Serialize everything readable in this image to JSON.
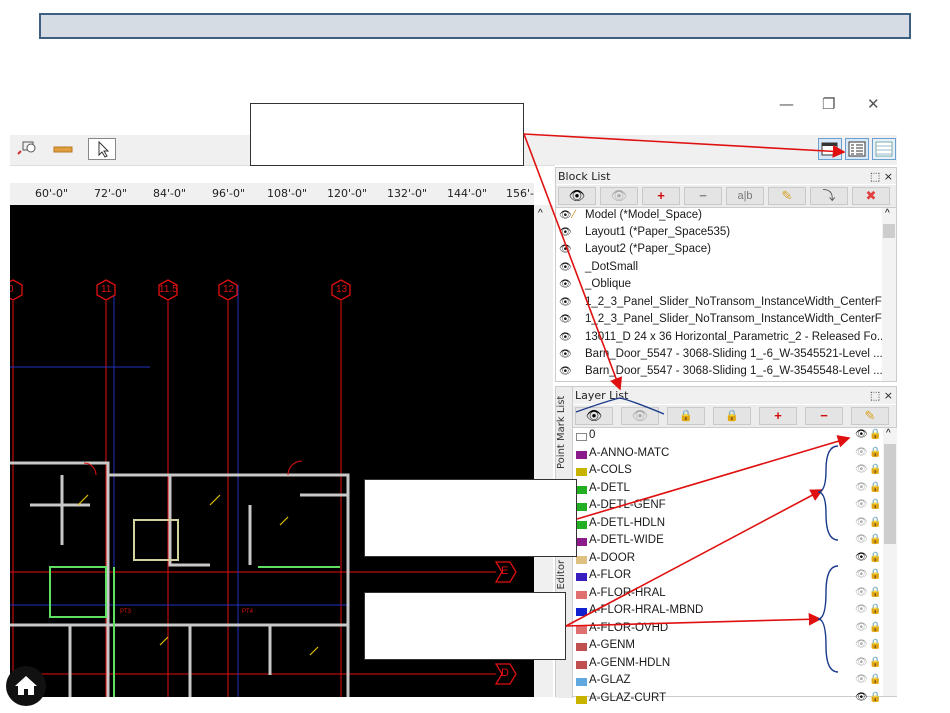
{
  "window": {
    "minimize": "—",
    "restore": "❐",
    "close": "✕"
  },
  "ruler": {
    "ticks": [
      "60'-0\"",
      "72'-0\"",
      "84'-0\"",
      "96'-0\"",
      "108'-0\"",
      "120'-0\"",
      "132'-0\"",
      "144'-0\"",
      "156'-"
    ]
  },
  "grid_bubbles": [
    "0",
    "11",
    "11.5",
    "12",
    "13"
  ],
  "row_bubbles": [
    "E",
    "D"
  ],
  "canvas_tags": [
    "PT3",
    "PT4"
  ],
  "block_list": {
    "title": "Block List",
    "pin": "⬚ ×",
    "tools": [
      "👁",
      "👁",
      "+",
      "−",
      "a|b",
      "✎",
      "⤵",
      "✖"
    ],
    "items": [
      "Model (*Model_Space)",
      "Layout1 (*Paper_Space535)",
      "Layout2 (*Paper_Space)",
      "_DotSmall",
      "_Oblique",
      "1_2_3_Panel_Slider_NoTransom_InstanceWidth_CenterFle...",
      "1_2_3_Panel_Slider_NoTransom_InstanceWidth_CenterFle...",
      "13011_D 24 x 36 Horizontal_Parametric_2 - Released Fo...",
      "Barn_Door_5547 - 3068-Sliding 1_-6_W-3545521-Level ...",
      "Barn_Door_5547 - 3068-Sliding 1_-6_W-3545548-Level ..."
    ]
  },
  "layer_list": {
    "title": "Layer List",
    "pin": "⬚ ×",
    "side_tabs": [
      "Point Mark List",
      "Property Editor"
    ],
    "tools": [
      "👁",
      "👁",
      "🔒",
      "🔒",
      "+",
      "−",
      "✎"
    ],
    "layers": [
      {
        "name": "0",
        "color": "#ffffff",
        "visible": true
      },
      {
        "name": "A-ANNO-MATC",
        "color": "#8b1a8b",
        "visible": false
      },
      {
        "name": "A-COLS",
        "color": "#c8b400",
        "visible": false
      },
      {
        "name": "A-DETL",
        "color": "#22b022",
        "visible": false
      },
      {
        "name": "A-DETL-GENF",
        "color": "#22b022",
        "visible": false
      },
      {
        "name": "A-DETL-HDLN",
        "color": "#22b022",
        "visible": false
      },
      {
        "name": "A-DETL-WIDE",
        "color": "#8b1a8b",
        "visible": false
      },
      {
        "name": "A-DOOR",
        "color": "#e0c080",
        "visible": true
      },
      {
        "name": "A-FLOR",
        "color": "#3a1fc0",
        "visible": false
      },
      {
        "name": "A-FLOR-HRAL",
        "color": "#e07070",
        "visible": false
      },
      {
        "name": "A-FLOR-HRAL-MBND",
        "color": "#1020d0",
        "visible": false
      },
      {
        "name": "A-FLOR-OVHD",
        "color": "#e07070",
        "visible": false
      },
      {
        "name": "A-GENM",
        "color": "#c05050",
        "visible": false
      },
      {
        "name": "A-GENM-HDLN",
        "color": "#c05050",
        "visible": false
      },
      {
        "name": "A-GLAZ",
        "color": "#60a8e0",
        "visible": false
      },
      {
        "name": "A-GLAZ-CURT",
        "color": "#c8b400",
        "visible": true
      }
    ]
  },
  "colors": {
    "accent": "#3f5f82",
    "annotation": "#e01010",
    "bracket": "#1a3a8a"
  }
}
